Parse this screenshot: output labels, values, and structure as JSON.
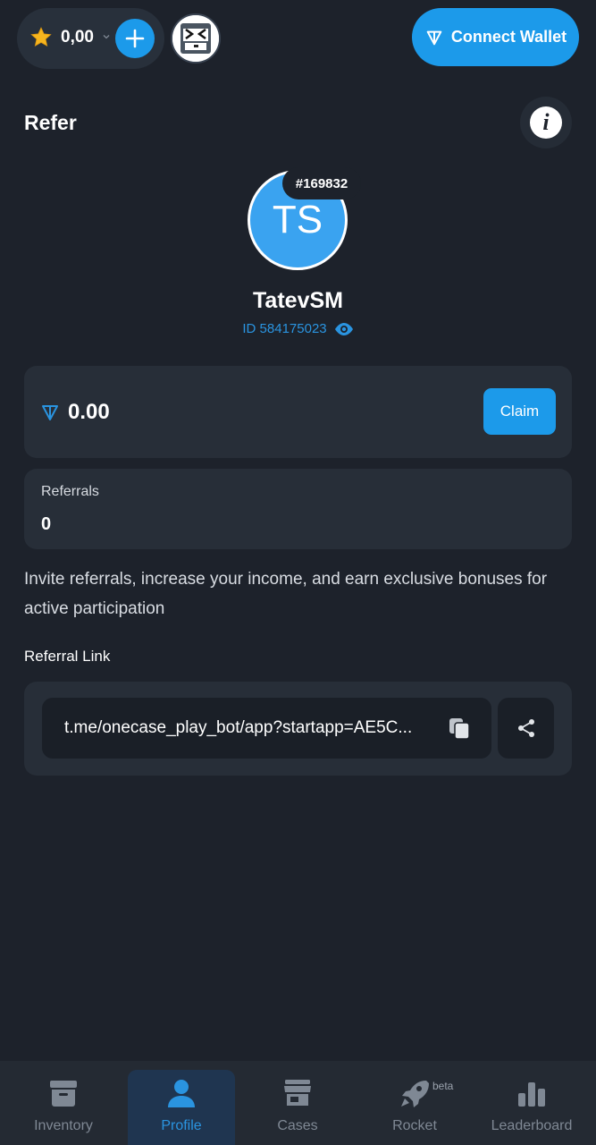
{
  "header": {
    "balance": "0,00",
    "connect_wallet_label": "Connect Wallet"
  },
  "page": {
    "title": "Refer"
  },
  "profile": {
    "initials": "TS",
    "rank": "#169832",
    "username": "TatevSM",
    "user_id": "ID 584175023"
  },
  "ton_balance": {
    "value": "0.00",
    "claim_label": "Claim"
  },
  "referrals": {
    "label": "Referrals",
    "count": "0"
  },
  "description": "Invite referrals, increase your income, and earn exclusive bonuses for active participation",
  "referral_link": {
    "label": "Referral Link",
    "value": "t.me/onecase_play_bot/app?startapp=AE5C..."
  },
  "nav": {
    "items": [
      {
        "label": "Inventory",
        "icon": "archive-box-icon",
        "active": false
      },
      {
        "label": "Profile",
        "icon": "user-icon",
        "active": true
      },
      {
        "label": "Cases",
        "icon": "store-icon",
        "active": false
      },
      {
        "label": "Rocket",
        "icon": "rocket-icon",
        "active": false,
        "badge": "beta"
      },
      {
        "label": "Leaderboard",
        "icon": "bar-chart-icon",
        "active": false
      }
    ]
  },
  "colors": {
    "accent": "#1c9aea",
    "background": "#1d222b",
    "card": "#272e38"
  }
}
